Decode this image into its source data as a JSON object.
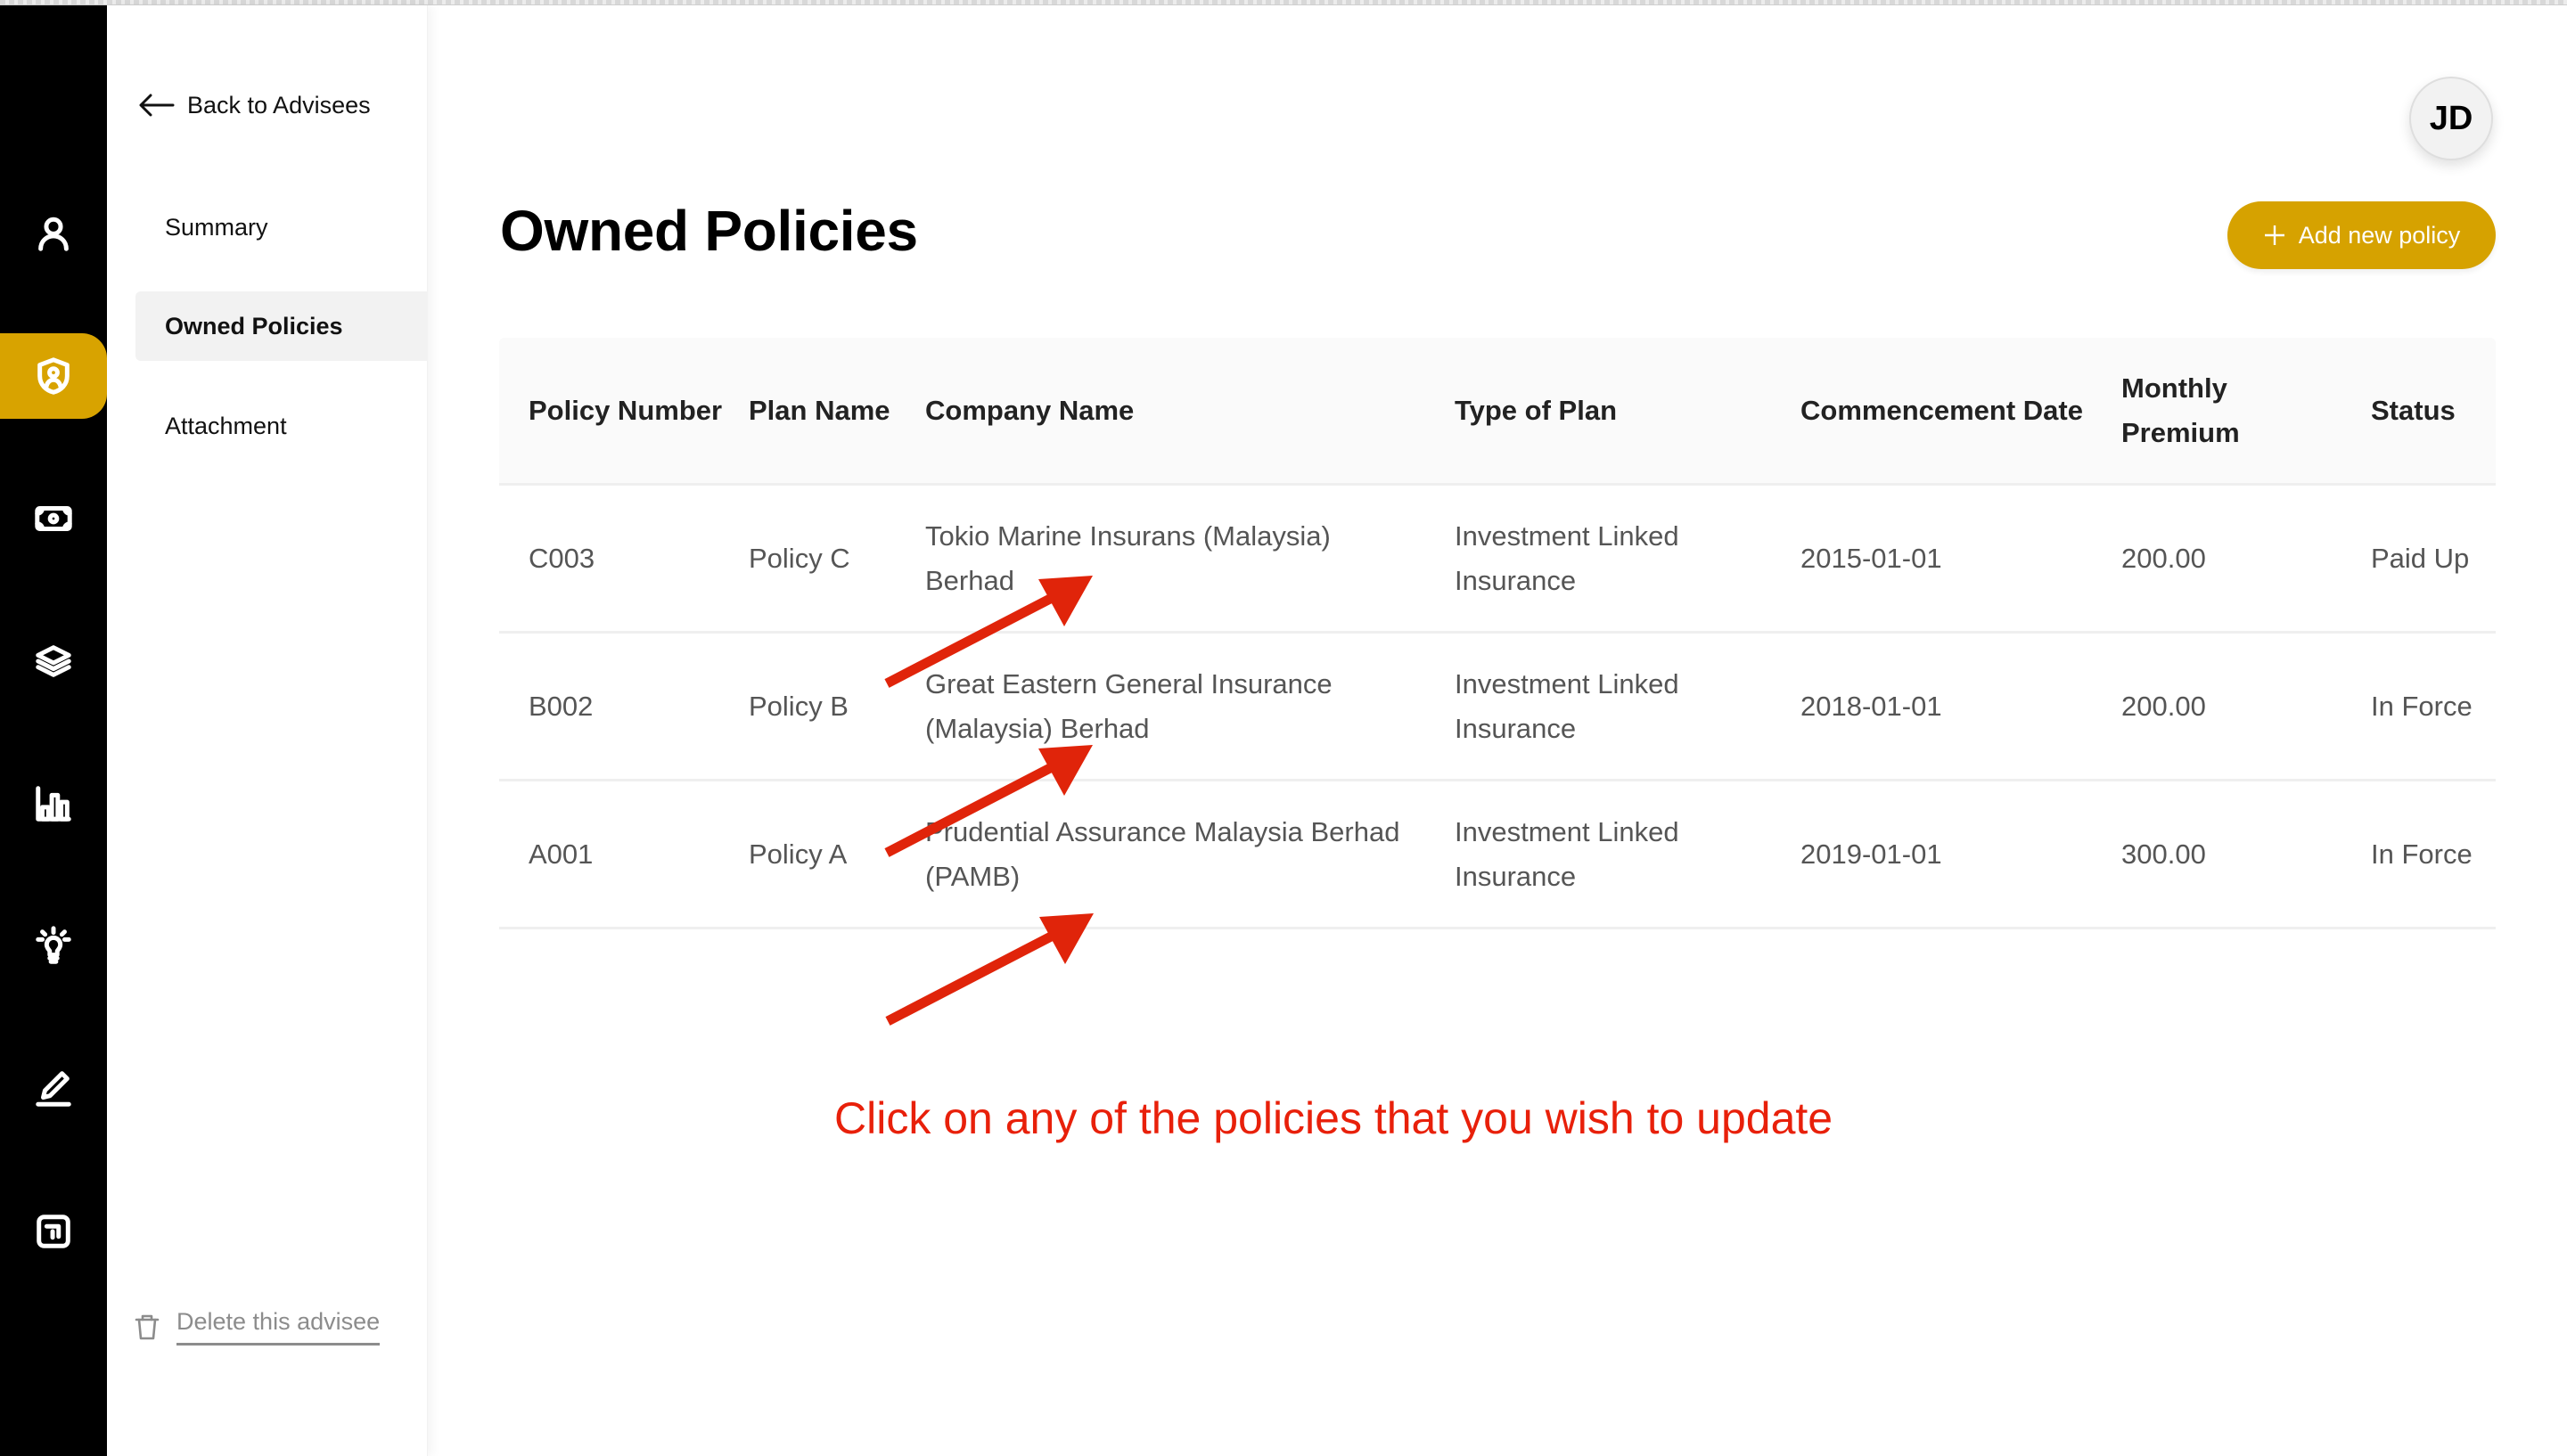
{
  "rail": {
    "items": [
      {
        "icon": "user-icon",
        "label": "Profile",
        "active": false
      },
      {
        "icon": "shield-user-icon",
        "label": "Policies",
        "active": true
      },
      {
        "icon": "money-icon",
        "label": "Finances",
        "active": false
      },
      {
        "icon": "layers-icon",
        "label": "Portfolio",
        "active": false
      },
      {
        "icon": "bar-chart-icon",
        "label": "Analytics",
        "active": false
      },
      {
        "icon": "lightbulb-icon",
        "label": "Insights",
        "active": false
      },
      {
        "icon": "pen-icon",
        "label": "Notes",
        "active": false
      },
      {
        "icon": "exit-icon",
        "label": "Exit",
        "active": false
      }
    ],
    "accent_color": "#d8a300"
  },
  "subnav": {
    "back_label": "Back to Advisees",
    "items": [
      {
        "label": "Summary",
        "active": false
      },
      {
        "label": "Owned Policies",
        "active": true
      },
      {
        "label": "Attachment",
        "active": false
      }
    ],
    "delete_label": "Delete this advisee"
  },
  "header": {
    "avatar_initials": "JD",
    "title": "Owned Policies",
    "add_button_label": "Add new policy"
  },
  "table": {
    "columns": [
      "Policy Number",
      "Plan Name",
      "Company Name",
      "Type of Plan",
      "Commencement Date",
      "Monthly Premium",
      "Status"
    ],
    "rows": [
      [
        "C003",
        "Policy C",
        "Tokio Marine Insurans (Malaysia) Berhad",
        "Investment Linked Insurance",
        "2015-01-01",
        "200.00",
        "Paid Up"
      ],
      [
        "B002",
        "Policy B",
        "Great Eastern General Insurance (Malaysia) Berhad",
        "Investment Linked Insurance",
        "2018-01-01",
        "200.00",
        "In Force"
      ],
      [
        "A001",
        "Policy A",
        "Prudential Assurance Malaysia Berhad (PAMB)",
        "Investment Linked Insurance",
        "2019-01-01",
        "300.00",
        "In Force"
      ]
    ]
  },
  "annotation": {
    "text": "Click on any of the policies that you wish to update",
    "color": "#e8200a",
    "arrow_count": 3
  }
}
